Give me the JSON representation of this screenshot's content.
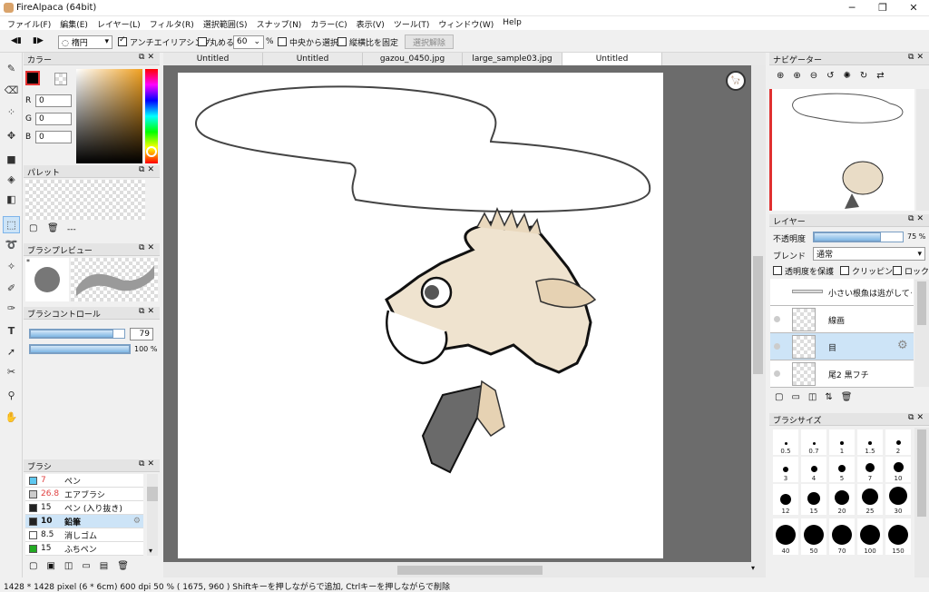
{
  "window": {
    "title": "FireAlpaca (64bit)",
    "minimize": "─",
    "maximize": "❐",
    "close": "✕"
  },
  "menu": [
    "ファイル(F)",
    "編集(E)",
    "レイヤー(L)",
    "フィルタ(R)",
    "選択範囲(S)",
    "スナップ(N)",
    "カラー(C)",
    "表示(V)",
    "ツール(T)",
    "ウィンドウ(W)",
    "Help"
  ],
  "toolbar": {
    "shape_value": "楕円",
    "antialias_label": "アンチエイリアシング",
    "round_label": "丸める",
    "round_value": "60",
    "round_unit": "%",
    "center_label": "中央から選択",
    "ratio_label": "縦横比を固定",
    "deselect_label": "選択解除"
  },
  "tabs": [
    "Untitled",
    "Untitled",
    "gazou_0450.jpg",
    "large_sample03.jpg",
    "Untitled"
  ],
  "color_panel": {
    "title": "カラー",
    "r_label": "R",
    "r_value": "0",
    "g_label": "G",
    "g_value": "0",
    "b_label": "B",
    "b_value": "0",
    "primary_color": "#000000",
    "secondary_color": "#ffffff"
  },
  "palette_panel": {
    "title": "パレット",
    "count_text": "---"
  },
  "brush_preview_panel": {
    "title": "ブラシプレビュー",
    "marker": "*"
  },
  "brush_control_panel": {
    "title": "ブラシコントロール",
    "size_value": "79",
    "opacity_value": "100 %",
    "size_level_pct": 88,
    "opacity_level_pct": 100
  },
  "brush_panel": {
    "title": "ブラシ",
    "items": [
      {
        "size": "7",
        "name": "ペン",
        "color": "#5ec8f0",
        "size_color": "#e04040"
      },
      {
        "size": "26.8",
        "name": "エアブラシ",
        "color": "#cccccc",
        "size_color": "#e04040"
      },
      {
        "size": "15",
        "name": "ペン (入り抜き)",
        "color": "#222222",
        "size_color": "#111111"
      },
      {
        "size": "10",
        "name": "鉛筆",
        "color": "#222222",
        "size_color": "#111111",
        "selected": true
      },
      {
        "size": "8.5",
        "name": "消しゴム",
        "color": "#ffffff",
        "size_color": "#111111"
      },
      {
        "size": "15",
        "name": "ふちペン",
        "color": "#22aa22",
        "size_color": "#111111"
      }
    ]
  },
  "navigator_panel": {
    "title": "ナビゲーター"
  },
  "layer_panel": {
    "title": "レイヤー",
    "opacity_label": "不透明度",
    "opacity_value": "75 %",
    "opacity_level_pct": 75,
    "blend_label": "ブレンド",
    "blend_value": "通常",
    "protect_label": "透明度を保護",
    "clipping_label": "クリッピング",
    "lock_label": "ロック",
    "layers": [
      {
        "name": "小さい根魚は逃がしてくれ"
      },
      {
        "name": "線画"
      },
      {
        "name": "目",
        "selected": true
      },
      {
        "name": "尾2 黒フチ"
      }
    ]
  },
  "brush_size_panel": {
    "title": "ブラシサイズ",
    "sizes": [
      "0.5",
      "0.7",
      "1",
      "1.5",
      "2",
      "3",
      "4",
      "5",
      "7",
      "10",
      "12",
      "15",
      "20",
      "25",
      "30",
      "40",
      "50",
      "70",
      "100",
      "150"
    ]
  },
  "status": {
    "text": "1428 * 1428 pixel   (6 * 6cm)   600 dpi   50 %   ( 1675, 960 )   Shiftキーを押しながらで追加, Ctrlキーを押しながらで削除"
  },
  "colors": {
    "accent": "#cde4f7",
    "canvas_bg": "#6c6c6c",
    "selected_row": "#cde4f7"
  }
}
